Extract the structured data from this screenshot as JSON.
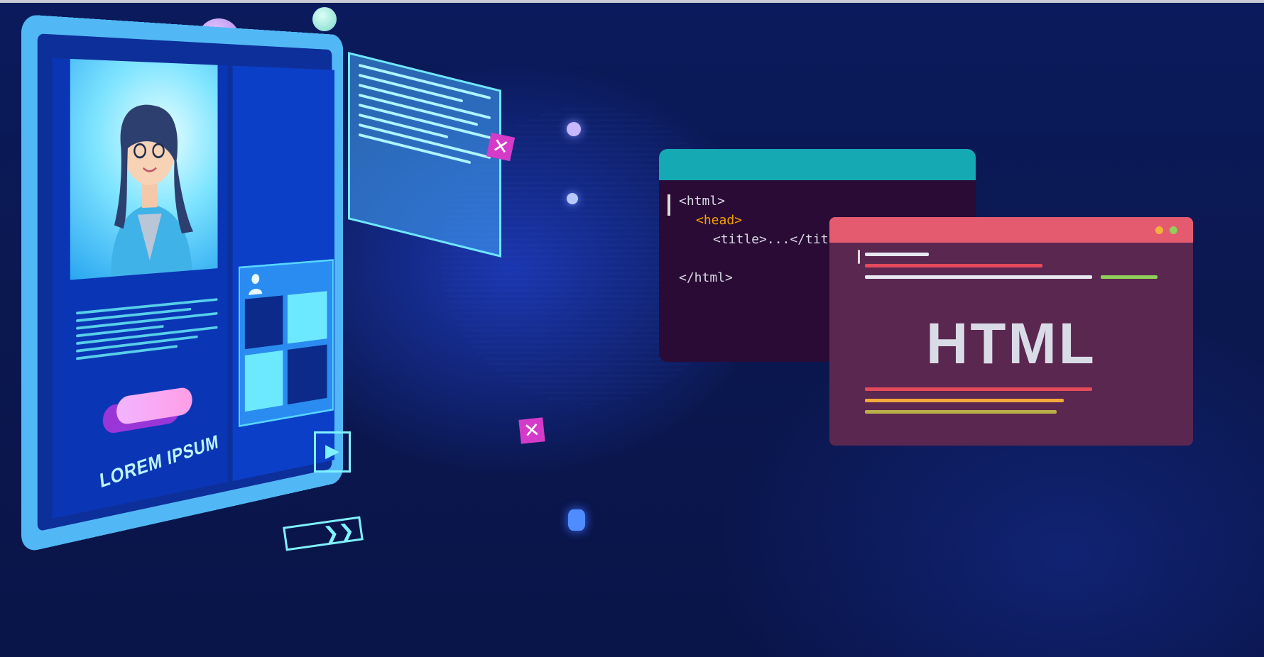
{
  "monitor": {
    "label": "LOREM IPSUM",
    "close_glyph": "✕",
    "play_glyph": "▶",
    "next_glyph": "❯❯"
  },
  "code_window": {
    "line1": "<html>",
    "line2": "<head>",
    "line3": "<title>...</title>",
    "line4": "</html>"
  },
  "html_window": {
    "title": "HTML"
  },
  "colors": {
    "background": "#0a1a5c",
    "code_bar": "#14a9b3",
    "html_bar": "#e45b70",
    "accent_cyan": "#6fe8ff",
    "accent_magenta": "#d43bc8"
  },
  "icons": [
    "close-icon",
    "play-icon",
    "next-arrow-icon",
    "user-icon"
  ]
}
